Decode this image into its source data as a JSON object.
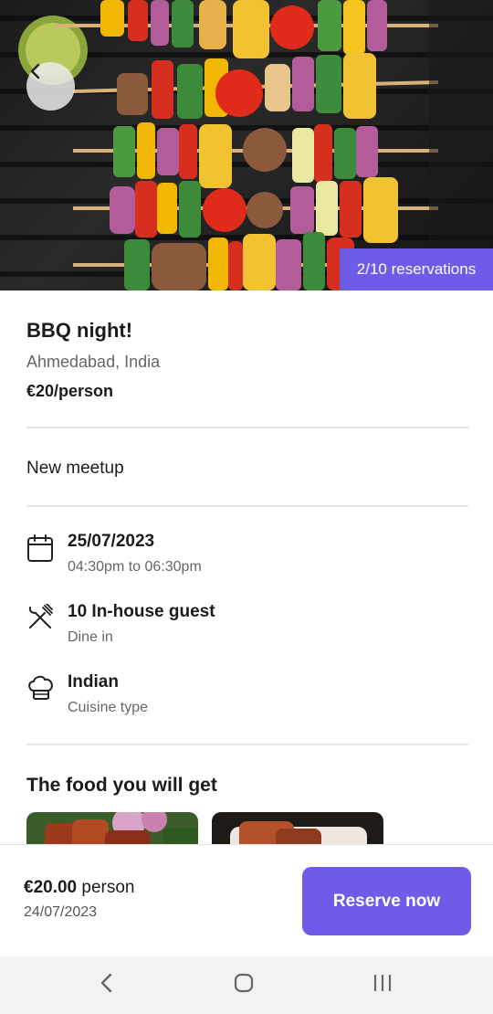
{
  "hero": {
    "reservations_badge": "2/10 reservations",
    "back_icon": "chevron-left-icon"
  },
  "event": {
    "title": "BBQ night!",
    "location": "Ahmedabad, India",
    "price": "€20/person",
    "meetup_type": "New meetup"
  },
  "details": [
    {
      "icon": "calendar-icon",
      "main": "25/07/2023",
      "sub": "04:30pm to 06:30pm"
    },
    {
      "icon": "fork-knife-icon",
      "main": "10 In-house guest",
      "sub": "Dine in"
    },
    {
      "icon": "chef-hat-icon",
      "main": "Indian",
      "sub": "Cuisine type"
    }
  ],
  "food": {
    "heading": "The food you will get"
  },
  "bottom": {
    "price_amount": "€20.00",
    "price_unit": "person",
    "date": "24/07/2023",
    "reserve_label": "Reserve now"
  },
  "colors": {
    "accent": "#6c5ce7"
  },
  "nav": {
    "back_icon": "nav-back-icon",
    "home_icon": "nav-home-icon",
    "recents_icon": "nav-recents-icon"
  }
}
